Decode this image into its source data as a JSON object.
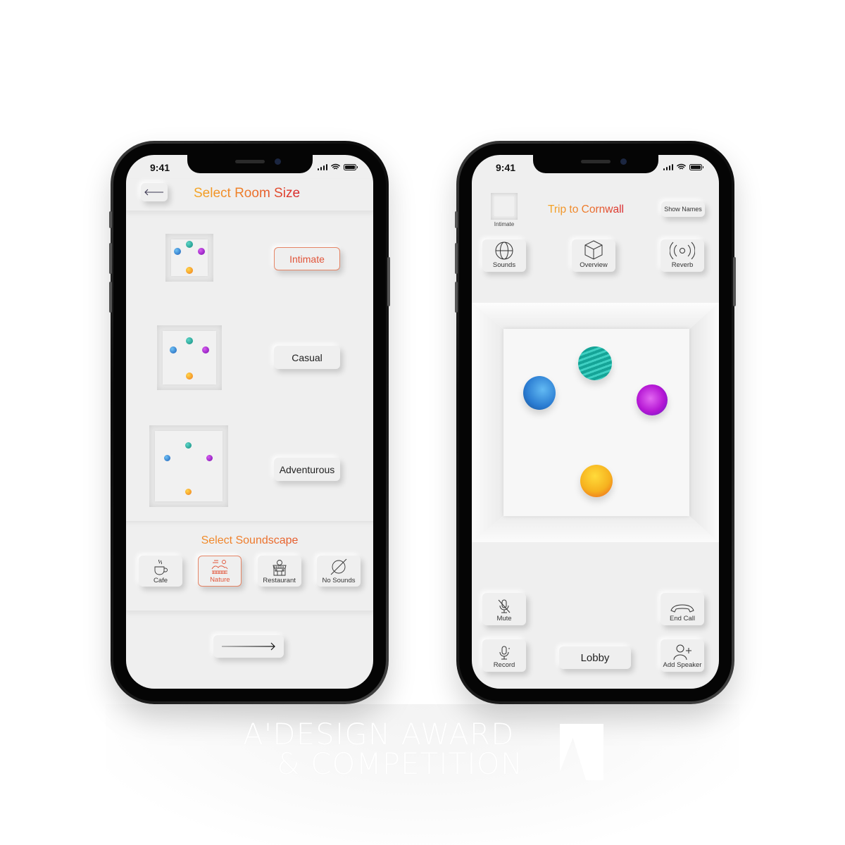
{
  "status_bar": {
    "time": "9:41"
  },
  "left_screen": {
    "title": "Select Room Size",
    "back_icon": "arrow-left-icon",
    "room_sizes": [
      {
        "label": "Intimate",
        "selected": true
      },
      {
        "label": "Casual",
        "selected": false
      },
      {
        "label": "Adventurous",
        "selected": false
      }
    ],
    "soundscape_title": "Select Soundscape",
    "soundscapes": [
      {
        "label": "Cafe",
        "icon": "coffee-cup-icon",
        "selected": false
      },
      {
        "label": "Nature",
        "icon": "nature-landscape-icon",
        "selected": true
      },
      {
        "label": "Restaurant",
        "icon": "restaurant-building-icon",
        "selected": false
      },
      {
        "label": "No Sounds",
        "icon": "empty-set-icon",
        "selected": false
      }
    ],
    "next_icon": "arrow-right-icon"
  },
  "right_screen": {
    "room_size_label": "Intimate",
    "title": "Trip to Cornwall",
    "show_names_label": "Show Names",
    "tools": [
      {
        "label": "Sounds",
        "icon": "globe-icon"
      },
      {
        "label": "Overview",
        "icon": "cube-icon"
      },
      {
        "label": "Reverb",
        "icon": "broadcast-icon"
      }
    ],
    "controls": {
      "mute": "Mute",
      "end_call": "End Call",
      "record": "Record",
      "lobby": "Lobby",
      "add_speaker": "Add Speaker"
    }
  },
  "colors": {
    "accent_start": "#f4a623",
    "accent_end": "#d8262e",
    "selected_border": "#e58566",
    "screen_bg": "#efefef",
    "speaker_teal": "#1fb3a4",
    "speaker_blue": "#3c8ee0",
    "speaker_purple": "#b517d4",
    "speaker_yellow": "#f6b21f"
  },
  "watermark": {
    "line1": "A'DESIGN AWARD",
    "line2": "& COMPETITION"
  }
}
